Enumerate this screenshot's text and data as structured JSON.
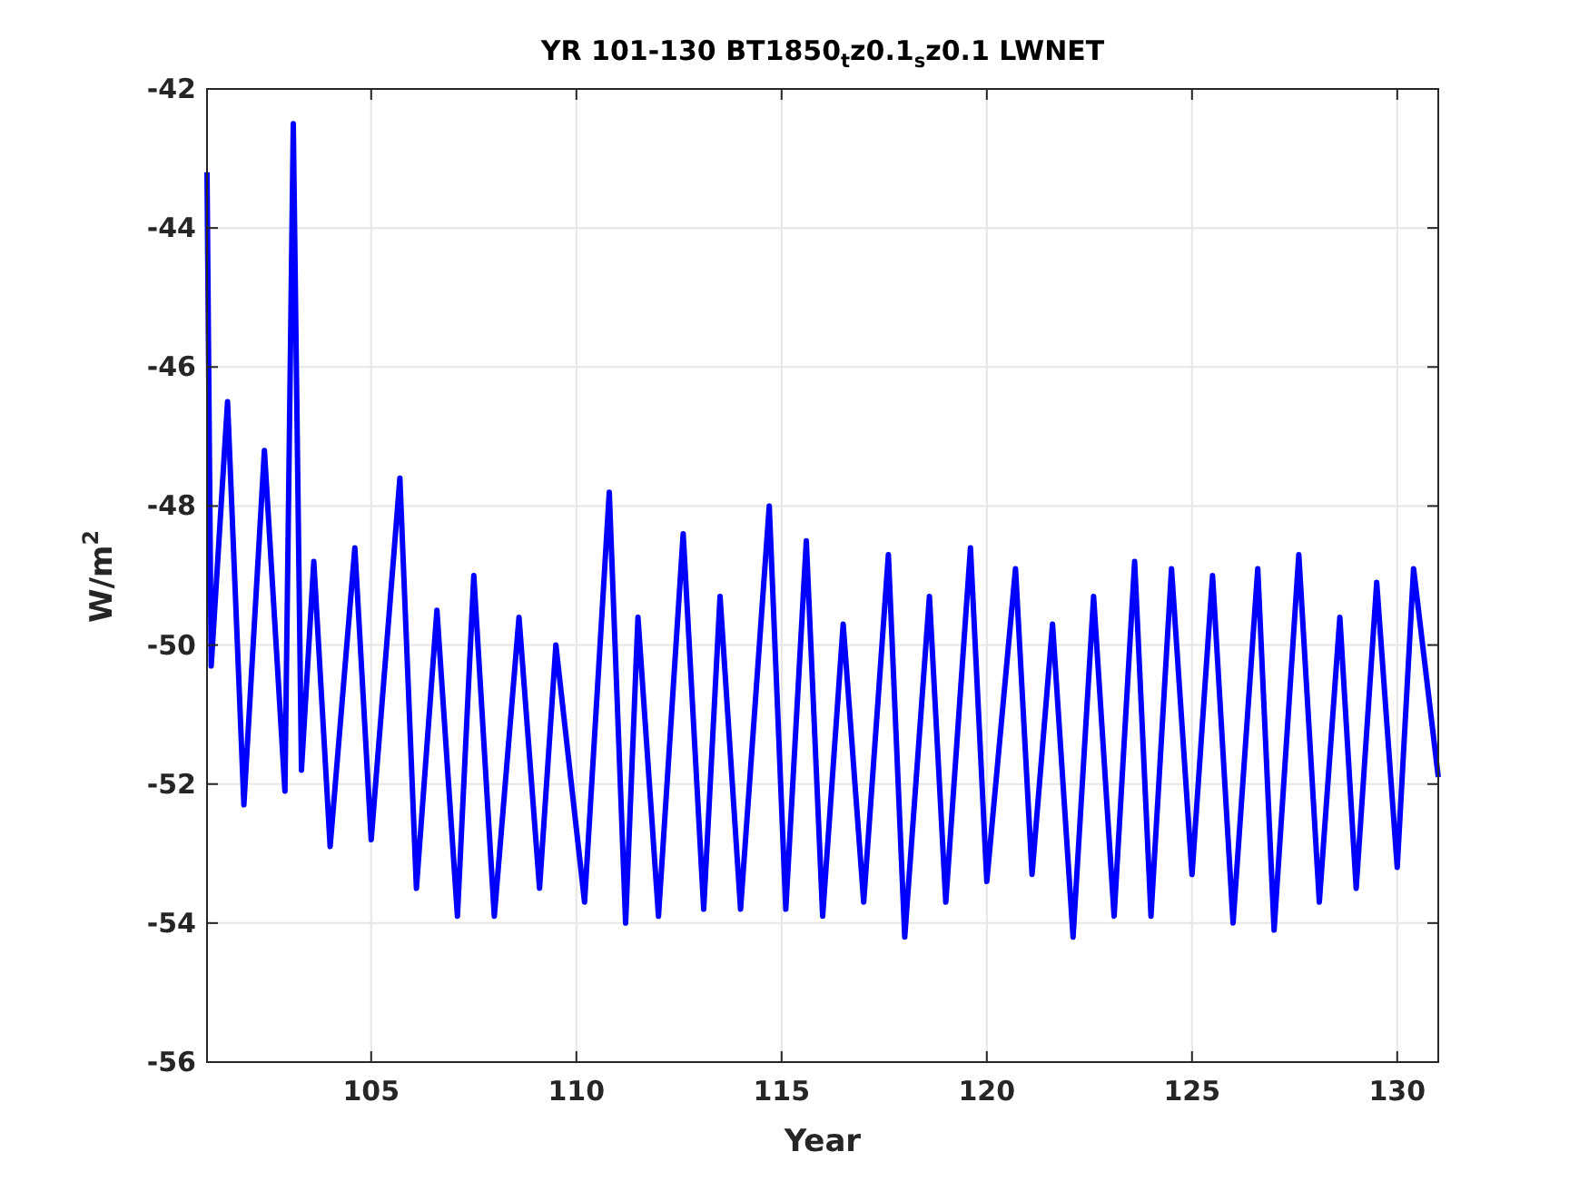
{
  "figure": {
    "chart_data": {
      "type": "line",
      "title": "YR 101-130 BT1850$_{t}$z0.1$_{s}$z0.1 LWNET",
      "xlabel": "Year",
      "ylabel": "W/m$^{2}$",
      "x": [
        101.0,
        101.1,
        101.5,
        101.9,
        102.4,
        102.9,
        103.1,
        103.3,
        103.6,
        104.0,
        104.6,
        105.0,
        105.7,
        106.1,
        106.6,
        107.1,
        107.5,
        108.0,
        108.6,
        109.1,
        109.5,
        110.2,
        110.8,
        111.2,
        111.5,
        112.0,
        112.6,
        113.1,
        113.5,
        114.0,
        114.7,
        115.1,
        115.6,
        116.0,
        116.5,
        117.0,
        117.6,
        118.0,
        118.6,
        119.0,
        119.6,
        120.0,
        120.7,
        121.1,
        121.6,
        122.1,
        122.6,
        123.1,
        123.6,
        124.0,
        124.5,
        125.0,
        125.5,
        126.0,
        126.6,
        127.0,
        127.6,
        128.1,
        128.6,
        129.0,
        129.5,
        130.0,
        130.4,
        131.0
      ],
      "grid": true,
      "series": [
        {
          "color": "#0000ff",
          "values": [
            -43.2,
            -50.3,
            -46.5,
            -52.3,
            -47.2,
            -52.1,
            -42.5,
            -51.8,
            -48.8,
            -52.9,
            -48.6,
            -52.8,
            -47.6,
            -53.5,
            -49.5,
            -53.9,
            -49.0,
            -53.9,
            -49.6,
            -53.5,
            -50.0,
            -53.7,
            -47.8,
            -54.0,
            -49.6,
            -53.9,
            -48.4,
            -53.8,
            -49.3,
            -53.8,
            -48.0,
            -53.8,
            -48.5,
            -53.9,
            -49.7,
            -53.7,
            -48.7,
            -54.2,
            -49.3,
            -53.7,
            -48.6,
            -53.4,
            -48.9,
            -53.3,
            -49.7,
            -54.2,
            -49.3,
            -53.9,
            -48.8,
            -53.9,
            -48.9,
            -53.3,
            -49.0,
            -54.0,
            -48.9,
            -54.1,
            -48.7,
            -53.7,
            -49.6,
            -53.5,
            -49.1,
            -53.2,
            -48.9,
            -51.9
          ]
        }
      ],
      "xlim": [
        101,
        131
      ],
      "ylim": [
        -56,
        -42
      ],
      "xticks": [
        105,
        110,
        115,
        120,
        125,
        130
      ],
      "yticks": [
        -56,
        -54,
        -52,
        -50,
        -48,
        -46,
        -44,
        -42
      ]
    }
  }
}
